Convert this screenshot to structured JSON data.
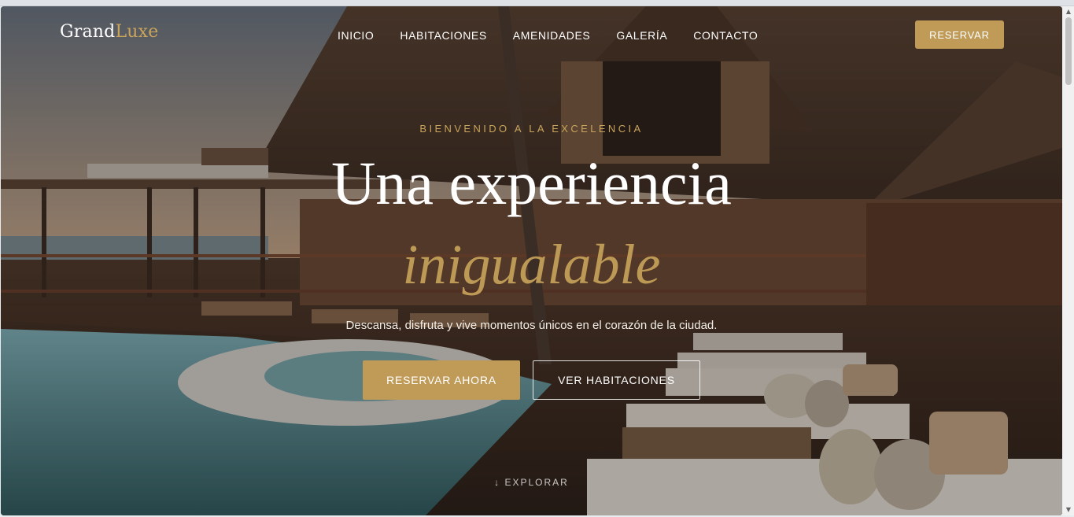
{
  "brand": {
    "part1": "Grand",
    "part2": "Luxe"
  },
  "nav": {
    "items": [
      "INICIO",
      "HABITACIONES",
      "AMENIDADES",
      "GALERÍA",
      "CONTACTO"
    ],
    "cta_label": "RESERVAR"
  },
  "hero": {
    "kicker": "BIENVENIDO A LA EXCELENCIA",
    "title_line1": "Una experiencia",
    "title_line2": "inigualable",
    "subtitle": "Descansa, disfruta y vive momentos únicos en el corazón de la ciudad.",
    "primary_cta": "RESERVAR AHORA",
    "secondary_cta": "VER HABITACIONES",
    "explore_label": "↓ EXPLORAR"
  },
  "colors": {
    "accent": "#c09a57",
    "text_light": "#ffffff"
  }
}
